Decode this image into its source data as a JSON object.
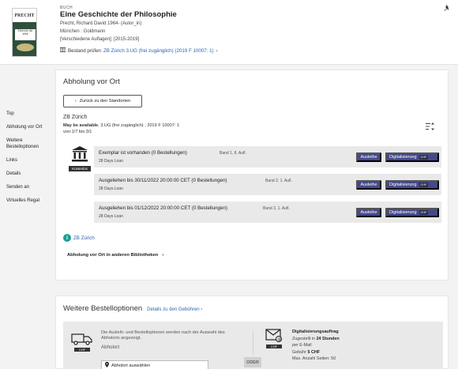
{
  "record": {
    "type_label": "BUCH",
    "title": "Eine Geschichte der Philosophie",
    "author_line": "Precht, Richard David 1964- (Autor_in)",
    "publisher_line": "München : Goldmann",
    "edition_line": "[Verschiedene Auflagen]; [2015-2019]",
    "availability_prefix": "Bestand prüfen",
    "availability_link": "ZB Zürich  3.UG (frei zugänglich) (2019 F 10007: 1)",
    "cover": {
      "band": "PRECHT",
      "subtitle": "Erkenne die Welt"
    }
  },
  "leftnav": {
    "items": [
      "Top",
      "Abholung vor Ort",
      "Weitere Bestelloptionen",
      "Links",
      "Details",
      "Senden an",
      "Virtuelles Regal"
    ]
  },
  "pickup": {
    "title": "Abholung vor Ort",
    "back_button": "Zurück zu den Standorten",
    "location_name": "ZB Zürich",
    "location_status_bold": "May be available",
    "location_status_rest": ", 3.UG (frei zugänglich) ; 2019 F 10007: 1",
    "range": "von:1/7 bis:3/1",
    "library_tag": "Kostenlos",
    "items": [
      {
        "status": "Exemplar ist vorhanden (0 Bestellungen)",
        "band": "Band 1, 8. Aufl.",
        "loan": "28 Days Loan"
      },
      {
        "status": "Ausgeliehen bis 30/11/2022 20:00:00 CET (0 Bestellungen)",
        "band": "Band 2, 1. Aufl.",
        "loan": "28 Days Loan"
      },
      {
        "status": "Ausgeliehen bis 01/12/2022 20:00:00 CET (0 Bestellungen)",
        "band": "Band 3, 1. Aufl.",
        "loan": "28 Days Loan"
      }
    ],
    "loan_button": "Ausleihe",
    "digi_button": "Digitalisierung",
    "chf_label": "CHF",
    "info_link": "ZB Zürich",
    "other_libraries": "Abholung vor Ort in anderen Bibliotheken"
  },
  "options": {
    "title": "Weitere Bestelloptionen",
    "fees_link": "Details zu den Gebühren",
    "pickup_info": "Die Ausleih- und Bestelloptionen werden nach der Auswahl des Abholorts angezeigt.",
    "pickup_label": "Abholort",
    "pickup_select": "Abholort auswählen",
    "truck_tag": "CHF",
    "mail_tag": "CHF",
    "oder": "ODER",
    "digi_title": "Digitalisierungsauftrag",
    "digi_line1_prefix": "Zugestellt in ",
    "digi_line1_bold": "24 Stunden",
    "digi_line2": "per E-Mail",
    "digi_line3_prefix": "Gebühr ",
    "digi_line3_bold": "5  CHF",
    "digi_line4": "Max. Anzahl Seiten: 50"
  },
  "colors": {
    "button": "#45498a",
    "link": "#2b63b0",
    "info": "#1a9f8f"
  }
}
